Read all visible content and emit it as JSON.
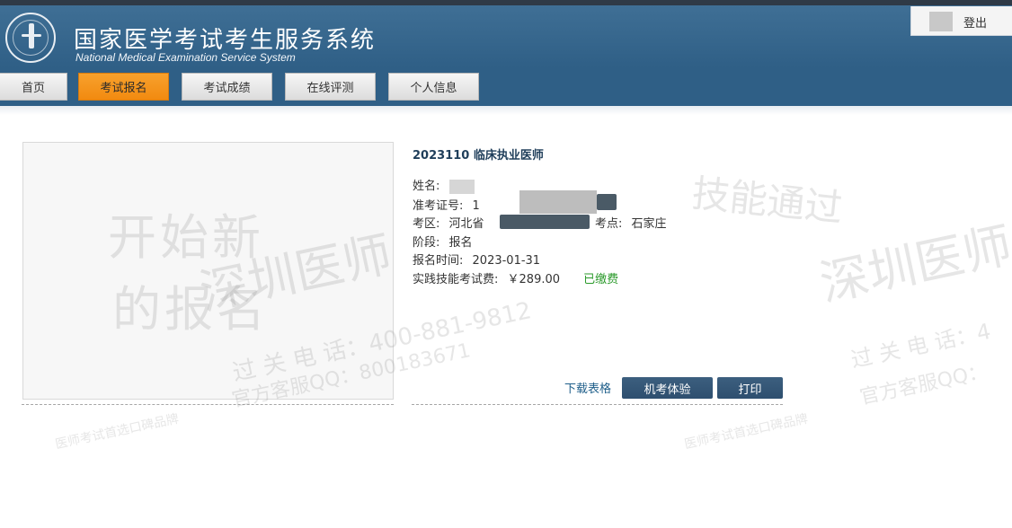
{
  "header": {
    "title_cn": "国家医学考试考生服务系统",
    "title_en": "National Medical Examination Service System",
    "logout_label": "登出"
  },
  "nav": {
    "items": [
      {
        "label": "首页"
      },
      {
        "label": "考试报名"
      },
      {
        "label": "考试成绩"
      },
      {
        "label": "在线评测"
      },
      {
        "label": "个人信息"
      }
    ],
    "active_index": 1
  },
  "registration": {
    "exam_title": "2023110 临床执业医师",
    "fields": {
      "name_label": "姓名:",
      "admission_label": "准考证号:",
      "admission_value": "1",
      "region_label": "考区:",
      "region_value": "河北省",
      "site_label": "考点:",
      "site_value": "石家庄",
      "stage_label": "阶段:",
      "stage_value": "报名",
      "time_label": "报名时间:",
      "time_value": "2023-01-31",
      "fee_label": "实践技能考试费:",
      "fee_value": "￥289.00",
      "fee_status": "已缴费"
    }
  },
  "actions": {
    "download_label": "下载表格",
    "exam_experience_label": "机考体验",
    "print_label": "打印"
  }
}
